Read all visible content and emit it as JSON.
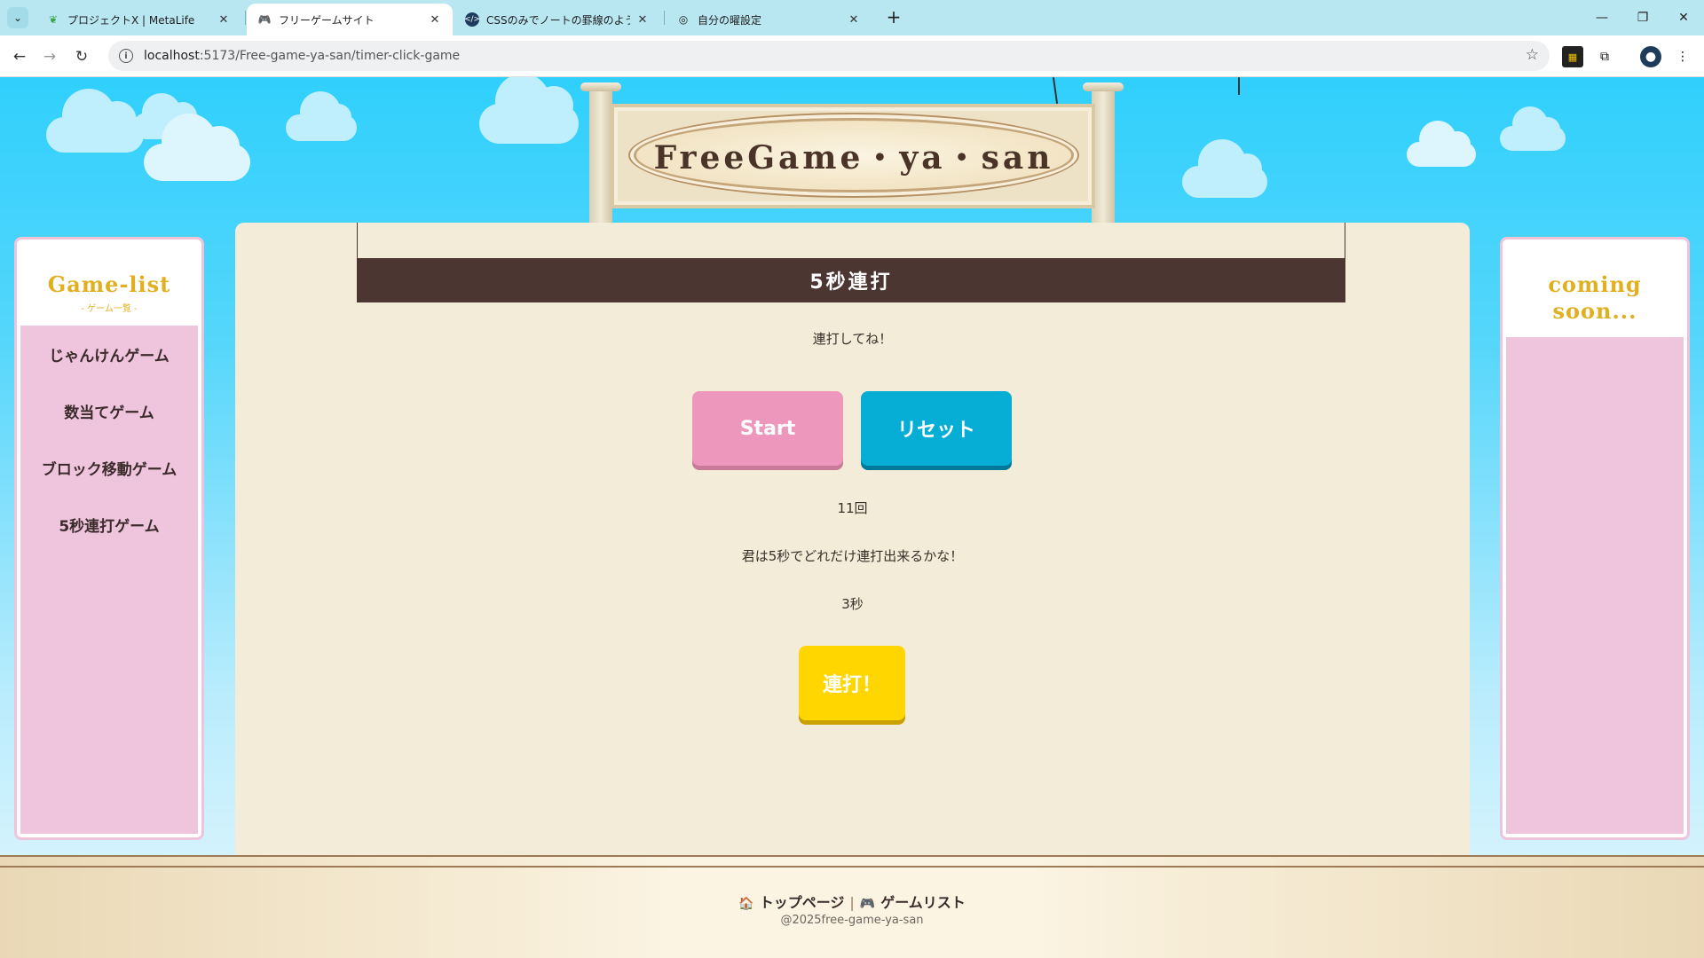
{
  "browser": {
    "tabs": [
      {
        "title": "プロジェクトX | MetaLife",
        "favicon": "metalife-icon"
      },
      {
        "title": "フリーゲームサイト",
        "favicon": "gamepad-icon"
      },
      {
        "title": "CSSのみでノートの罫線のようなスタ",
        "favicon": "code-icon"
      },
      {
        "title": "自分の曜設定",
        "favicon": "spiral-icon"
      }
    ],
    "active_tab": 1,
    "url_host": "localhost",
    "url_rest": ":5173/Free-game-ya-san/timer-click-game"
  },
  "site": {
    "title": "FreeGame・ya・san"
  },
  "sidebar_left": {
    "title": "Game-list",
    "subtitle": "- ゲーム一覧 -",
    "items": [
      {
        "label": "じゃんけんゲーム"
      },
      {
        "label": "数当てゲーム"
      },
      {
        "label": "ブロック移動ゲーム"
      },
      {
        "label": "5秒連打ゲーム"
      }
    ]
  },
  "sidebar_right": {
    "title_line1": "coming",
    "title_line2": "soon..."
  },
  "game": {
    "title": "5秒連打",
    "prompt": "連打してね！",
    "start_label": "Start",
    "reset_label": "リセット",
    "count_text": "11回",
    "challenge_text": "君は5秒でどれだけ連打出来るかな！",
    "timer_text": "3秒",
    "tap_label": "連打！"
  },
  "footer": {
    "top_link": "トップページ",
    "list_link": "ゲームリスト",
    "separator": "|",
    "copyright": "@2025free-game-ya-san"
  },
  "colors": {
    "sky": "#30d0fc",
    "board_text": "#4a3428",
    "header_bg": "#4b3631",
    "start_btn": "#ec97bb",
    "reset_btn": "#06aed6",
    "tap_btn": "#ffd600",
    "sidebar_list": "#efc5dd",
    "sidebar_title": "#e0b021"
  }
}
